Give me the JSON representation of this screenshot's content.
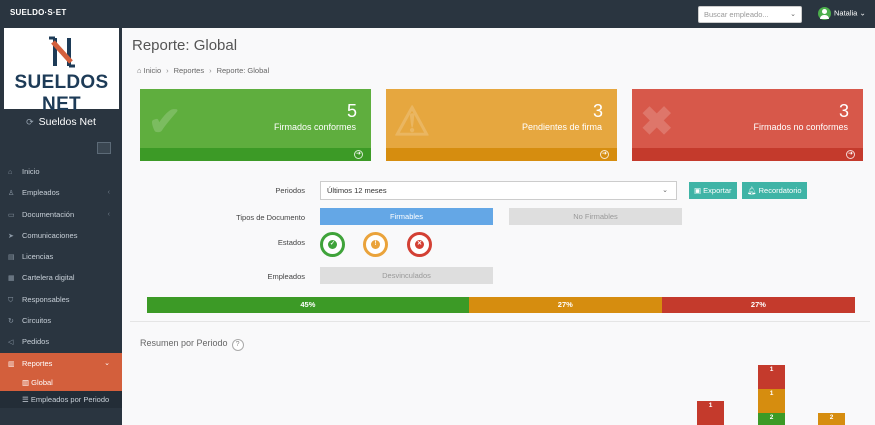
{
  "topbar": {
    "brand": "SUELDO·S·ET",
    "search_placeholder": "Buscar empleado...",
    "user_name": "Natalia"
  },
  "sidebar": {
    "logo_text": "SUELDOS NET",
    "company": "Sueldos Net",
    "items": [
      {
        "label": "Inicio",
        "icon": "home-icon",
        "arrow": false
      },
      {
        "label": "Empleados",
        "icon": "users-icon",
        "arrow": true
      },
      {
        "label": "Documentación",
        "icon": "folder-icon",
        "arrow": true
      },
      {
        "label": "Comunicaciones",
        "icon": "send-icon",
        "arrow": false
      },
      {
        "label": "Licencias",
        "icon": "calendar-icon",
        "arrow": false
      },
      {
        "label": "Cartelera digital",
        "icon": "board-icon",
        "arrow": false
      },
      {
        "label": "Responsables",
        "icon": "shield-icon",
        "arrow": false
      },
      {
        "label": "Circuitos",
        "icon": "cycle-icon",
        "arrow": false
      },
      {
        "label": "Pedidos",
        "icon": "megaphone-icon",
        "arrow": false
      },
      {
        "label": "Reportes",
        "icon": "chart-icon",
        "arrow": true
      }
    ],
    "subitems": [
      {
        "label": "Global"
      },
      {
        "label": "Empleados por Periodo"
      }
    ]
  },
  "page": {
    "title": "Reporte: Global",
    "breadcrumb": [
      "Inicio",
      "Reportes",
      "Reporte: Global"
    ]
  },
  "tiles": [
    {
      "value": "5",
      "label": "Firmados conformes",
      "color": "#5fae3e"
    },
    {
      "value": "3",
      "label": "Pendientes de firma",
      "color": "#e6a73f"
    },
    {
      "value": "3",
      "label": "Firmados no conformes",
      "color": "#d7584a"
    }
  ],
  "filters": {
    "periodos_label": "Periodos",
    "periodos_value": "Últimos 12 meses",
    "export_label": "Exportar",
    "reminder_label": "Recordatorio",
    "tipos_label": "Tipos de Documento",
    "firmables": "Firmables",
    "no_firmables": "No Firmables",
    "estados_label": "Estados",
    "empleados_label": "Empleados",
    "desvinculados": "Desvinculados"
  },
  "progress": [
    {
      "label": "45%",
      "pct": 45.45,
      "color": "#3c9a26"
    },
    {
      "label": "27%",
      "pct": 27.27,
      "color": "#d68d0f"
    },
    {
      "label": "27%",
      "pct": 27.28,
      "color": "#c43a2c"
    }
  ],
  "summary": {
    "title": "Resumen por Periodo",
    "help": "?",
    "chart_data": {
      "type": "bar",
      "stacked": true,
      "categories": [
        "",
        "",
        ""
      ],
      "series": [
        {
          "values": [
            0,
            2,
            0
          ],
          "color": "#3c9a26"
        },
        {
          "values": [
            0,
            1,
            2
          ],
          "color": "#d68d0f"
        },
        {
          "values": [
            1,
            1,
            0
          ],
          "color": "#c43a2c"
        }
      ]
    }
  }
}
